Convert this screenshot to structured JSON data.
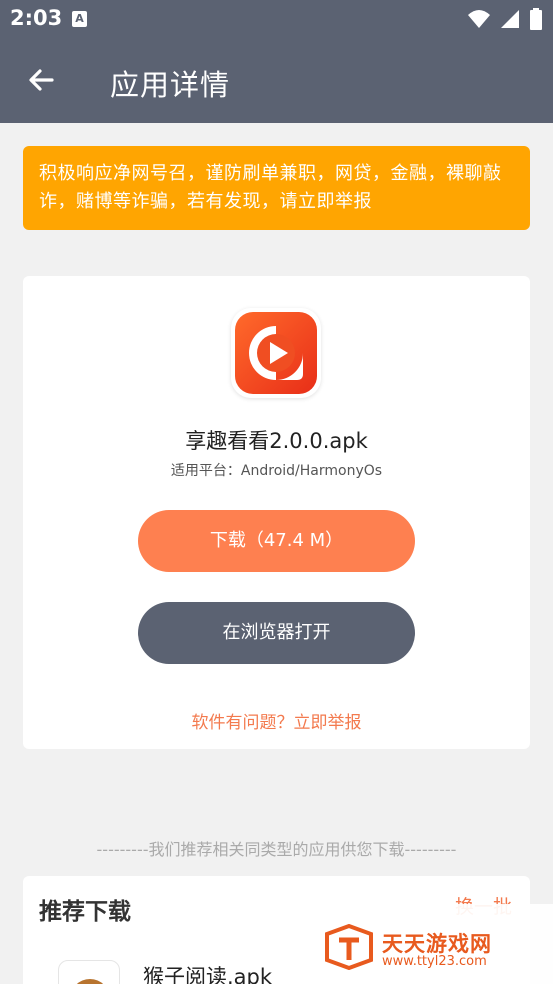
{
  "status_bar": {
    "time": "2:03",
    "notification_icon": "A",
    "icons": [
      "wifi-icon",
      "signal-icon",
      "battery-icon"
    ]
  },
  "header": {
    "title": "应用详情",
    "back_icon": "arrow-left-icon"
  },
  "warning": {
    "text": "积极响应净网号召，谨防刷单兼职，网贷，金融，裸聊敲诈，赌博等诈骗，若有发现，请立即举报"
  },
  "app": {
    "icon": "play-icon",
    "name": "享趣看看2.0.0.apk",
    "platform": "适用平台：Android/HarmonyOs",
    "download_label": "下载（47.4 M）",
    "browser_label": "在浏览器打开",
    "report_label": "软件有问题？立即举报"
  },
  "recommend": {
    "divider_text": "---------我们推荐相关同类型的应用供您下载---------",
    "title": "推荐下载",
    "more_label": "换一批",
    "items": [
      {
        "name": "猴子阅读.apk",
        "icon": "monkey-icon"
      }
    ]
  },
  "watermark": {
    "main": "天天游戏网",
    "sub": "www.ttyl23.com"
  },
  "colors": {
    "header_bg": "#5b6272",
    "warning_bg": "#ffa501",
    "download_btn": "#fe8050",
    "browser_btn": "#5b6272",
    "accent_text": "#f37a4e",
    "page_bg": "#f1f1f1"
  }
}
